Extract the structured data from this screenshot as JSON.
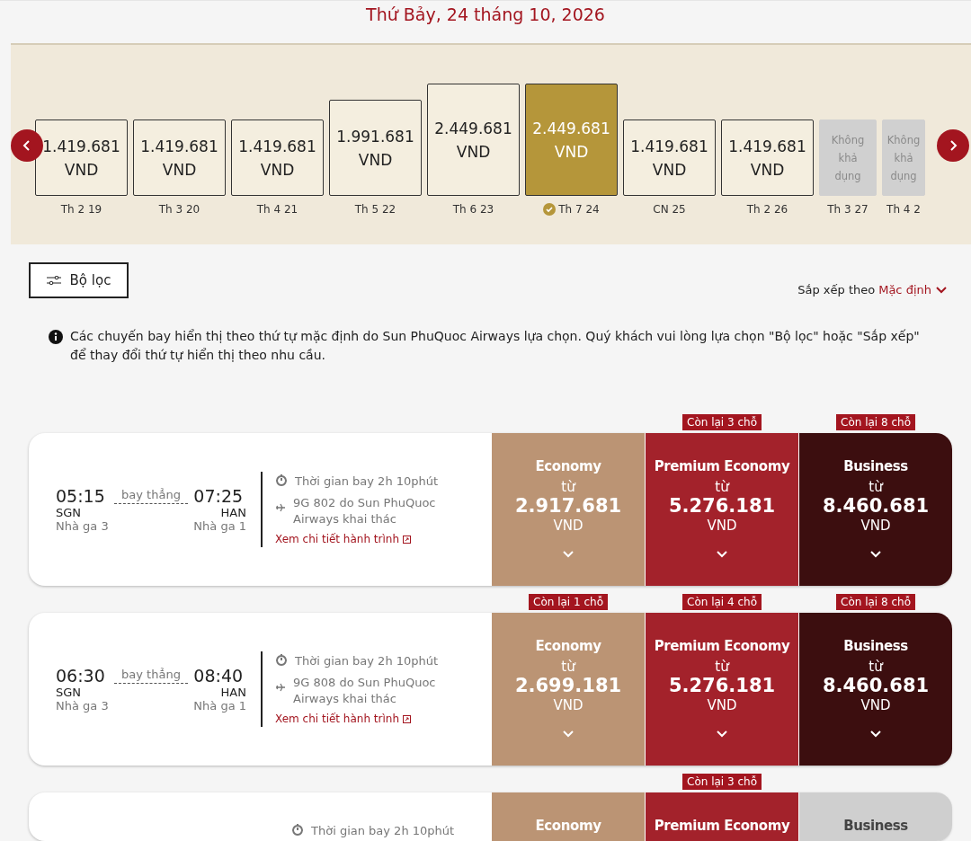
{
  "date_title": "Thứ Bảy, 24 tháng 10, 2026",
  "days": [
    {
      "price": "1.419.681",
      "currency": "VND",
      "label": "Th 2 19",
      "available": true,
      "selected": false
    },
    {
      "price": "1.419.681",
      "currency": "VND",
      "label": "Th 3 20",
      "available": true,
      "selected": false
    },
    {
      "price": "1.419.681",
      "currency": "VND",
      "label": "Th 4 21",
      "available": true,
      "selected": false
    },
    {
      "price": "1.991.681",
      "currency": "VND",
      "label": "Th 5 22",
      "available": true,
      "selected": false
    },
    {
      "price": "2.449.681",
      "currency": "VND",
      "label": "Th 6 23",
      "available": true,
      "selected": false
    },
    {
      "price": "2.449.681",
      "currency": "VND",
      "label": "Th 7 24",
      "available": true,
      "selected": true
    },
    {
      "price": "1.419.681",
      "currency": "VND",
      "label": "CN 25",
      "available": true,
      "selected": false
    },
    {
      "price": "1.419.681",
      "currency": "VND",
      "label": "Th 2 26",
      "available": true,
      "selected": false
    },
    {
      "note": "Không khả dụng",
      "label": "Th 3 27",
      "available": false,
      "selected": false
    },
    {
      "note": "Không khả dụng",
      "label": "Th 4 2",
      "available": false,
      "selected": false
    }
  ],
  "filter_button": "Bộ lọc",
  "sort": {
    "label": "Sắp xếp theo",
    "value": "Mặc định"
  },
  "info": "Các chuyến bay hiển thị theo thứ tự mặc định do Sun PhuQuoc Airways lựa chọn. Quý khách vui lòng lựa chọn \"Bộ lọc\" hoặc \"Sắp xếp\" để thay đổi thứ tự hiển thị theo nhu cầu.",
  "flights": [
    {
      "depart_time": "05:15",
      "stop": "bay thẳng",
      "arrive_time": "07:25",
      "from": "SGN",
      "to": "HAN",
      "from_terminal": "Nhà ga 3",
      "to_terminal": "Nhà ga 1",
      "duration": "Thời gian bay  2h 10phút",
      "operator": "9G 802 do Sun PhuQuoc Airways khai thác",
      "details_link": "Xem chi tiết hành trình",
      "fares": [
        {
          "kind": "economy",
          "name": "Economy",
          "from": "từ",
          "price": "2.917.681",
          "currency": "VND"
        },
        {
          "kind": "premium",
          "name": "Premium Economy",
          "from": "từ",
          "price": "5.276.181",
          "currency": "VND",
          "badge": "Còn lại 3 chỗ"
        },
        {
          "kind": "business",
          "name": "Business",
          "from": "từ",
          "price": "8.460.681",
          "currency": "VND",
          "badge": "Còn lại 8 chỗ"
        }
      ]
    },
    {
      "depart_time": "06:30",
      "stop": "bay thẳng",
      "arrive_time": "08:40",
      "from": "SGN",
      "to": "HAN",
      "from_terminal": "Nhà ga 3",
      "to_terminal": "Nhà ga 1",
      "duration": "Thời gian bay  2h 10phút",
      "operator": "9G 808 do Sun PhuQuoc Airways khai thác",
      "details_link": "Xem chi tiết hành trình",
      "fares": [
        {
          "kind": "economy",
          "name": "Economy",
          "from": "từ",
          "price": "2.699.181",
          "currency": "VND",
          "badge": "Còn lại 1 chỗ"
        },
        {
          "kind": "premium",
          "name": "Premium Economy",
          "from": "từ",
          "price": "5.276.181",
          "currency": "VND",
          "badge": "Còn lại 4 chỗ"
        },
        {
          "kind": "business",
          "name": "Business",
          "from": "từ",
          "price": "8.460.681",
          "currency": "VND",
          "badge": "Còn lại 8 chỗ"
        }
      ]
    },
    {
      "duration": "Thời gian bay  2h 10phút",
      "fares": [
        {
          "kind": "economy",
          "name": "Economy"
        },
        {
          "kind": "premium",
          "name": "Premium Economy",
          "badge": "Còn lại 3 chỗ"
        },
        {
          "kind": "unavailable",
          "name": "Business"
        }
      ]
    }
  ]
}
